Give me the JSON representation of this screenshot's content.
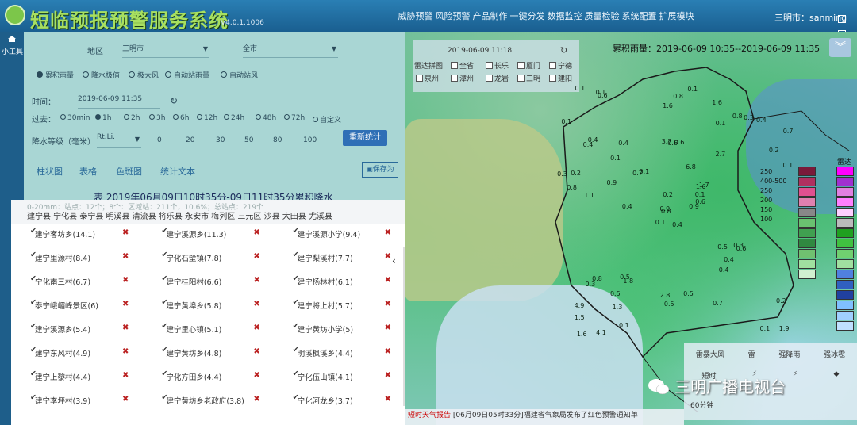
{
  "header": {
    "title": "短临预报预警服务系统",
    "version": "V4.0.1.1006",
    "nav": [
      "威胁预警",
      "风险预警",
      "产品制作",
      "一键分发",
      "数据监控",
      "质量检验",
      "系统配置",
      "扩展模块"
    ],
    "user": "三明市：sanming"
  },
  "sidebar": {
    "label": "小工具"
  },
  "query": {
    "area_label": "地区",
    "city": "三明市",
    "scope": "全市",
    "types": [
      {
        "label": "累积雨量",
        "checked": true
      },
      {
        "label": "降水极值",
        "checked": false
      },
      {
        "label": "极大风",
        "checked": false
      },
      {
        "label": "自动站雨量",
        "checked": false
      },
      {
        "label": "自动站风",
        "checked": false
      }
    ],
    "time_label": "时间：",
    "time_value": "2019-06-09 11:35",
    "past_label": "过去：",
    "past_options": [
      {
        "label": "30min",
        "checked": false
      },
      {
        "label": "1h",
        "checked": true
      },
      {
        "label": "2h",
        "checked": false
      },
      {
        "label": "3h",
        "checked": false
      },
      {
        "label": "6h",
        "checked": false
      },
      {
        "label": "12h",
        "checked": false
      },
      {
        "label": "24h",
        "checked": false
      },
      {
        "label": "48h",
        "checked": false
      },
      {
        "label": "72h",
        "checked": false
      },
      {
        "label": "自定义",
        "checked": false
      }
    ],
    "grade_label": "降水等级（毫米）",
    "grade_mode": "Rt.Li.",
    "thresholds": [
      "0",
      "20",
      "30",
      "50",
      "80",
      "100"
    ],
    "recount_button": "重新统计",
    "tabs": [
      "柱状图",
      "表格",
      "色斑图",
      "统计文本"
    ],
    "save_button": "保存为"
  },
  "table": {
    "title": "表 2019年06月09日10时35分-09日11时35分累积降水",
    "stats": "0-20mm：站点：12个；8个：区域站：211个，10.6%；总站点：219个",
    "counties": "建宁县 宁化县 泰宁县 明溪县 清流县 将乐县 永安市 梅列区 三元区 沙县 大田县 尤溪县",
    "stations": [
      "建宁客坊乡(14.1)",
      "建宁溪源乡(11.3)",
      "建宁溪源小学(9.4)",
      "建宁里源村(8.4)",
      "宁化石壁镇(7.8)",
      "建宁梨溪村(7.7)",
      "宁化南三村(6.7)",
      "建宁桂阳村(6.6)",
      "建宁杨林村(6.1)",
      "泰宁峨嵋峰景区(6)",
      "建宁黄埠乡(5.8)",
      "建宁将上村(5.7)",
      "建宁溪源乡(5.4)",
      "建宁里心镇(5.1)",
      "建宁黄坊小学(5)",
      "建宁东风村(4.9)",
      "建宁黄坊乡(4.8)",
      "明溪枫溪乡(4.4)",
      "建宁上黎村(4.4)",
      "宁化方田乡(4.4)",
      "宁化伍山镇(4.1)",
      "建宁李坪村(3.9)",
      "建宁黄坊乡老政府(3.8)",
      "宁化河龙乡(3.7)"
    ]
  },
  "map": {
    "title": "累积雨量：2019-06-09 10:35--2019-06-09 11:35",
    "date": "2019-06-09 11:18",
    "region_label": "雷达拼图",
    "regions": [
      {
        "label": "全省",
        "checked": true
      },
      {
        "label": "长乐",
        "checked": false
      },
      {
        "label": "厦门",
        "checked": false
      },
      {
        "label": "宁德",
        "checked": false
      },
      {
        "label": "泉州",
        "checked": false
      },
      {
        "label": "漳州",
        "checked": false
      },
      {
        "label": "龙岩",
        "checked": false
      },
      {
        "label": "三明",
        "checked": false
      },
      {
        "label": "建阳",
        "checked": false
      }
    ],
    "values": [
      "0.4",
      "0.4",
      "0.8",
      "4.9",
      "1.6",
      "1.8",
      "1.6",
      "0.6",
      "0.1",
      "0.9",
      "0.6",
      "1.9",
      "1.1",
      "0.7",
      "0.1",
      "2.7",
      "4.1",
      "3.7",
      "6.8",
      "0.8",
      "0.1",
      "1.5",
      "1.3",
      "0.6",
      "1.7",
      "0.6",
      "0.4",
      "1.6",
      "0.8",
      "0.5",
      "0.1",
      "0.9",
      "2.8",
      "0.2",
      "0.4",
      "0.8",
      "0.5",
      "0.1",
      "0.2",
      "0.3",
      "0.1",
      "0.7",
      "0.9",
      "0.4",
      "0.1",
      "0.3",
      "0.1",
      "1.6",
      "0.5",
      "0.6",
      "0.3",
      "0.2",
      "0.1",
      "0.4",
      "0.7",
      "0.5",
      "0.1",
      "0.1",
      "0.5",
      "0.4",
      "0.8",
      "0.4",
      "0.2",
      "0.1",
      "0.3"
    ],
    "legend_left": [
      "250",
      "400-500",
      "250",
      "200",
      "150",
      "100"
    ],
    "legend_title": "雷达",
    "legend_left_colors": [
      "#7a1a3a",
      "#b03060",
      "#e05090",
      "#e080b0",
      "#888888",
      "#6ac070",
      "#40a050",
      "#308840",
      "#70c070",
      "#a0e0a0",
      "#d0f0d0"
    ],
    "legend_right_colors": [
      "#ff00ff",
      "#a030d0",
      "#e080e0",
      "#ff80ff",
      "#ffd0ff",
      "#bbbbbb",
      "#20a020",
      "#40c040",
      "#70d070",
      "#a0e0a0",
      "#5080e0",
      "#3060c0",
      "#2040a0",
      "#80c0ff",
      "#a0d0ff",
      "#c0e0ff"
    ],
    "warnings_head": [
      "雷暴大风",
      "雷",
      "强降雨",
      "强冰雹"
    ],
    "warnings_icons": [
      "短时",
      "",
      "",
      ""
    ],
    "warn_count": "60分钟",
    "watermark": "三明广播电视台",
    "ticker_label": "短时天气报告",
    "ticker_text": "[06月09日05时33分]福建省气象局发布了红色预警通知单"
  }
}
